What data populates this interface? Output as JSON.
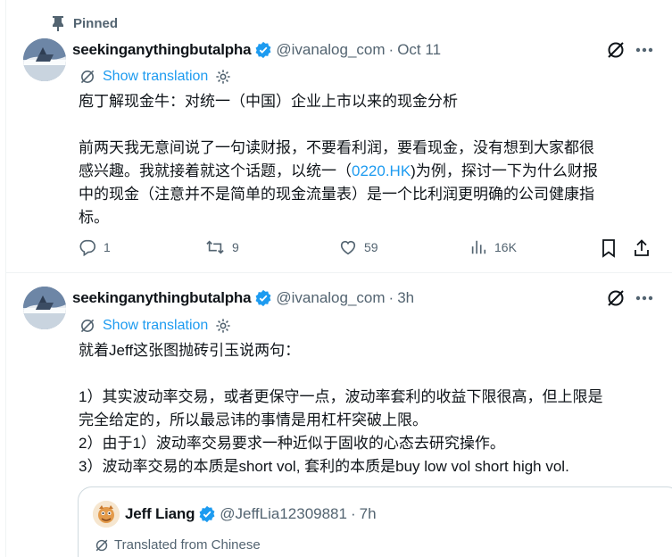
{
  "pinned_label": "Pinned",
  "tweets": [
    {
      "name": "seekinganythingbutalpha",
      "handle": "@ivanalog_com",
      "separator": "·",
      "time": "Oct 11",
      "show_translation": "Show translation",
      "lines": [
        "庖丁解现金牛：对统一（中国）企业上市以来的现金分析",
        "前两天我无意间说了一句读财报，不要看利润，要看现金，没有想到大家都很",
        "感兴趣。我就接着就这个话题，以统一（",
        "0220.HK",
        ")为例，探讨一下为什么财报",
        "中的现金（注意并不是简单的现金流量表）是一个比利润更明确的公司健康指",
        "标。"
      ],
      "replies": "1",
      "reposts": "9",
      "likes": "59",
      "views": "16K"
    },
    {
      "name": "seekinganythingbutalpha",
      "handle": "@ivanalog_com",
      "separator": "·",
      "time": "3h",
      "show_translation": "Show translation",
      "lines": [
        "就着Jeff这张图抛砖引玉说两句：",
        "1）其实波动率交易，或者更保守一点，波动率套利的收益下限很高，但上限是",
        "完全给定的，所以最忌讳的事情是用杠杆突破上限。",
        "2）由于1）波动率交易要求一种近似于固收的心态去研究操作。",
        "3）波动率交易的本质是short vol, 套利的本质是buy low vol short high vol."
      ]
    }
  ],
  "quote": {
    "name": "Jeff Liang",
    "handle": "@JeffLia12309881",
    "separator": "·",
    "time": "7h",
    "translated_label": "Translated from Chinese"
  },
  "colors": {
    "accent": "#1d9bf0",
    "secondary_text": "#536471",
    "border": "#eff3f4"
  },
  "icons": [
    "pin-icon",
    "verified-badge-icon",
    "grok-icon",
    "more-icon",
    "translate-icon",
    "gear-icon",
    "reply-icon",
    "repost-icon",
    "like-icon",
    "views-icon",
    "bookmark-icon",
    "share-icon"
  ]
}
